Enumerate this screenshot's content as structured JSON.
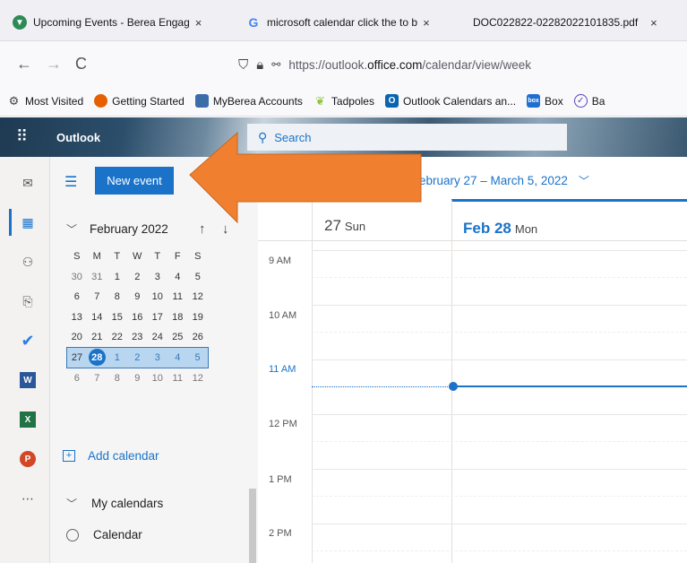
{
  "browser": {
    "tabs": [
      {
        "title": "Upcoming Events - Berea Engag",
        "icon": "berea-icon",
        "close": "×"
      },
      {
        "title": "microsoft calendar click the to b",
        "icon": "google-icon",
        "close": "×"
      },
      {
        "title": "DOC022822-02282022101835.pdf",
        "icon": "",
        "close": "×"
      }
    ],
    "nav": {
      "back": "←",
      "forward": "→",
      "reload": "C"
    },
    "url": {
      "prefix": "https://outlook.",
      "domain": "office.com",
      "path": "/calendar/view/week"
    },
    "bookmarks": [
      {
        "label": "Most Visited",
        "icon": "gear-icon"
      },
      {
        "label": "Getting Started",
        "icon": "firefox-icon"
      },
      {
        "label": "MyBerea Accounts",
        "icon": "myberea-icon"
      },
      {
        "label": "Tadpoles",
        "icon": "tadpoles-icon"
      },
      {
        "label": "Outlook Calendars an...",
        "icon": "outlook-icon"
      },
      {
        "label": "Box",
        "icon": "box-icon"
      },
      {
        "label": "Ba",
        "icon": "circle-icon"
      }
    ]
  },
  "outlook": {
    "app_name": "Outlook",
    "search_placeholder": "Search",
    "new_event_label": "New event",
    "date_range": "ebruary 27 – March 5, 2022",
    "mini_calendar": {
      "month_label": "February 2022",
      "weekday_headers": [
        "S",
        "M",
        "T",
        "W",
        "T",
        "F",
        "S"
      ],
      "weeks": [
        [
          "30",
          "31",
          "1",
          "2",
          "3",
          "4",
          "5"
        ],
        [
          "6",
          "7",
          "8",
          "9",
          "10",
          "11",
          "12"
        ],
        [
          "13",
          "14",
          "15",
          "16",
          "17",
          "18",
          "19"
        ],
        [
          "20",
          "21",
          "22",
          "23",
          "24",
          "25",
          "26"
        ],
        [
          "27",
          "28",
          "1",
          "2",
          "3",
          "4",
          "5"
        ],
        [
          "6",
          "7",
          "8",
          "9",
          "10",
          "11",
          "12"
        ]
      ],
      "today": "28"
    },
    "add_calendar_label": "Add calendar",
    "my_calendars_label": "My calendars",
    "calendars": [
      "Calendar"
    ],
    "days": [
      {
        "num": "27",
        "name": "Sun"
      },
      {
        "num": "Feb 28",
        "name": "Mon"
      }
    ],
    "time_slots": [
      "9 AM",
      "10 AM",
      "11 AM",
      "12 PM",
      "1 PM",
      "2 PM"
    ],
    "accent_color": "#1a73c9",
    "arrow_color": "#f08030"
  }
}
